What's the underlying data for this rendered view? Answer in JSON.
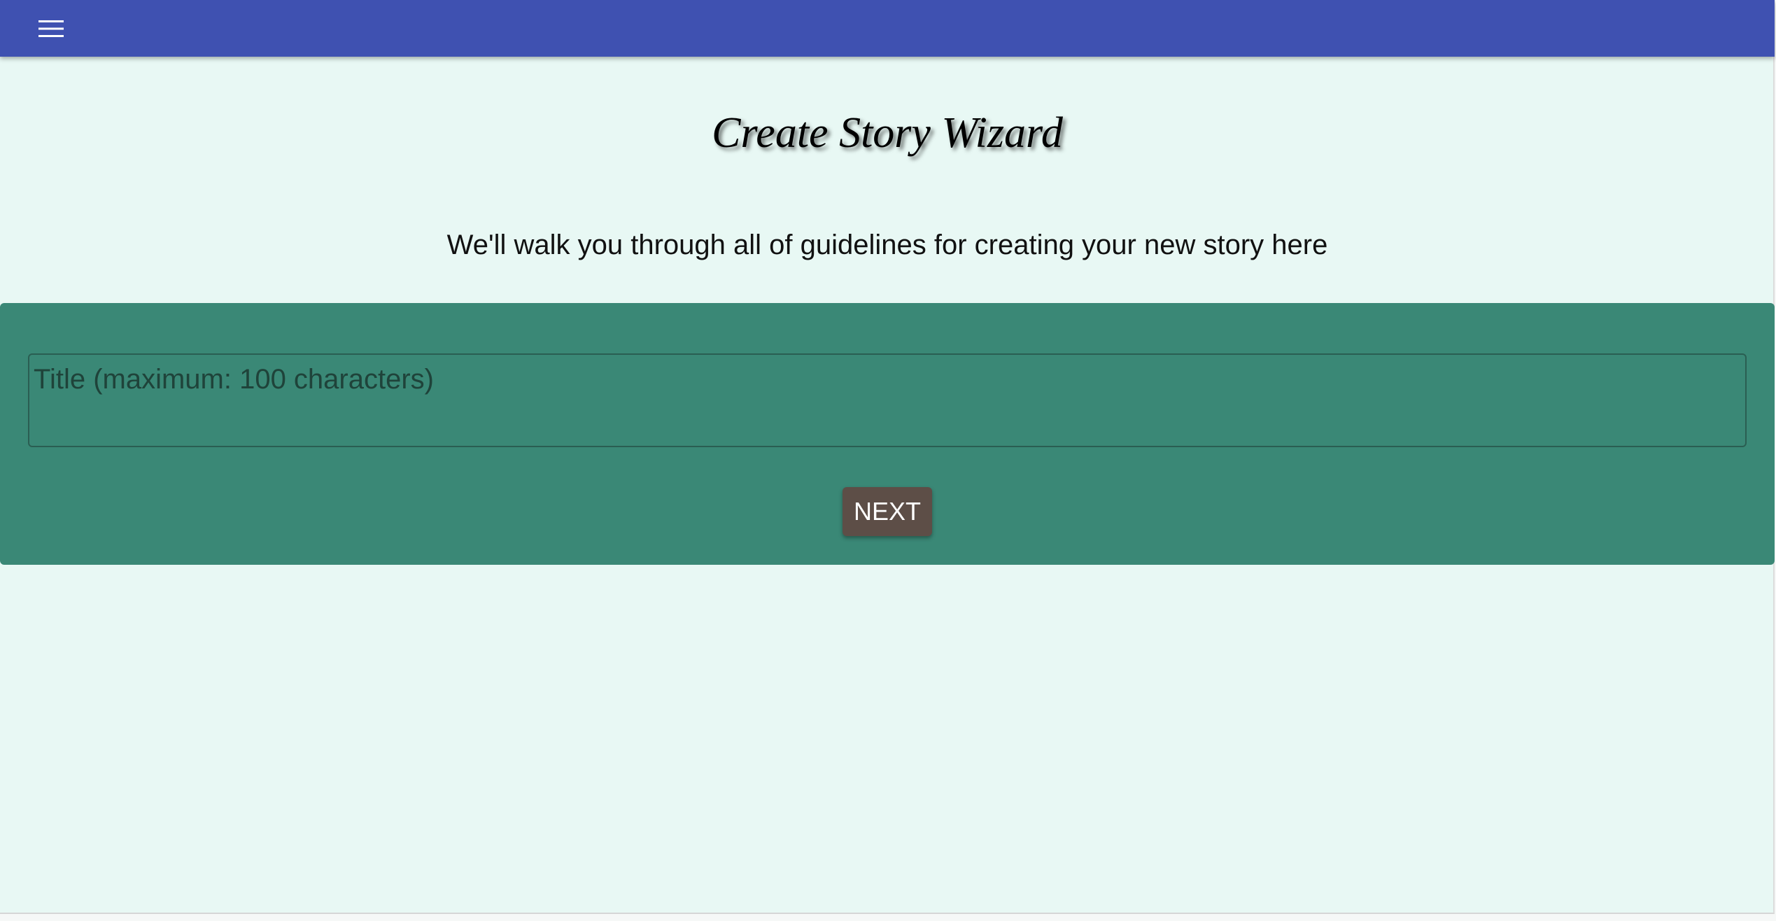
{
  "topbar": {
    "menu_icon": "hamburger-menu-icon",
    "color": "#3f51b1"
  },
  "page": {
    "title": "Create Story Wizard",
    "subtitle": "We'll walk you through all of guidelines for creating your new story here",
    "background": "#e8f8f4"
  },
  "form": {
    "panel_color": "#3a8876",
    "title_field": {
      "value": "",
      "placeholder": "Title (maximum: 100 characters)"
    },
    "next_label": "NEXT",
    "next_color": "#5d4e47"
  }
}
